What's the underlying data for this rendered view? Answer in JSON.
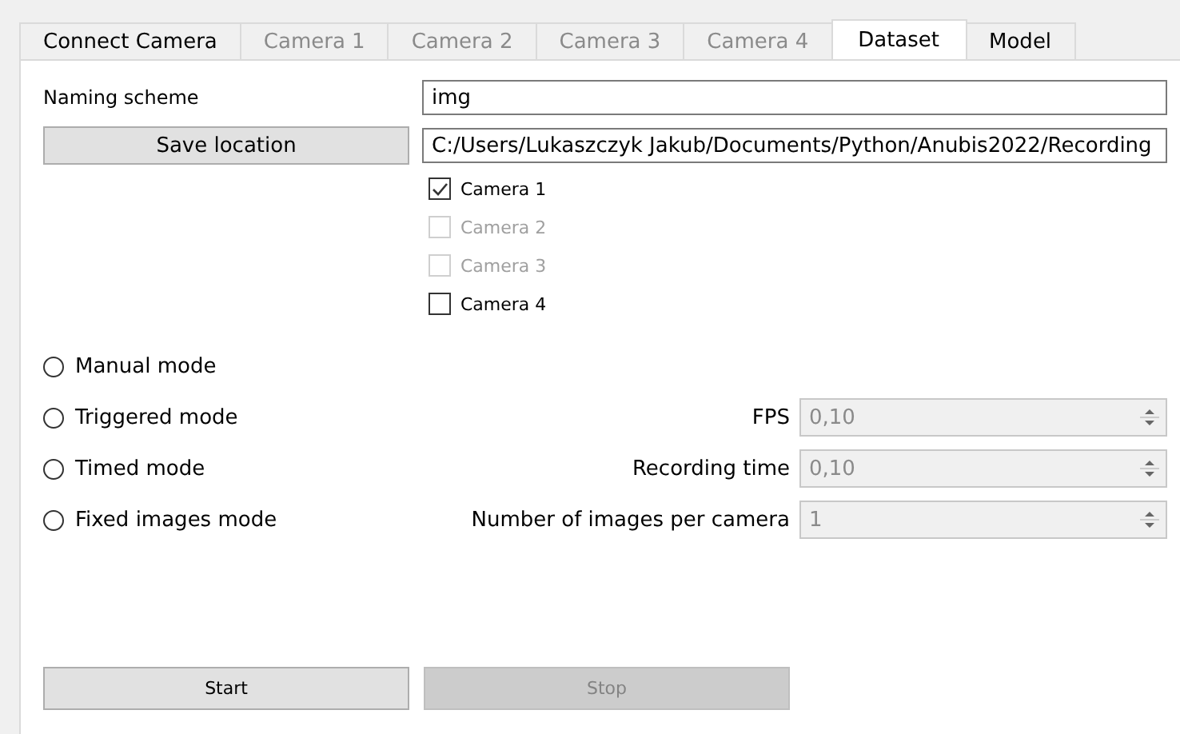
{
  "tabs": [
    {
      "label": "Connect Camera",
      "selected": false,
      "disabled": false
    },
    {
      "label": "Camera 1",
      "selected": false,
      "disabled": true
    },
    {
      "label": "Camera 2",
      "selected": false,
      "disabled": true
    },
    {
      "label": "Camera 3",
      "selected": false,
      "disabled": true
    },
    {
      "label": "Camera 4",
      "selected": false,
      "disabled": true
    },
    {
      "label": "Dataset",
      "selected": true,
      "disabled": false
    },
    {
      "label": "Model",
      "selected": false,
      "disabled": false
    }
  ],
  "naming_scheme": {
    "label": "Naming scheme",
    "value": "img"
  },
  "save_location": {
    "button": "Save location",
    "value": "C:/Users/Lukaszczyk Jakub/Documents/Python/Anubis2022/Recording"
  },
  "cameras": [
    {
      "label": "Camera 1",
      "checked": true,
      "disabled": false
    },
    {
      "label": "Camera 2",
      "checked": false,
      "disabled": true
    },
    {
      "label": "Camera 3",
      "checked": false,
      "disabled": true
    },
    {
      "label": "Camera 4",
      "checked": false,
      "disabled": false
    }
  ],
  "modes": [
    {
      "label": "Manual mode",
      "selected": false
    },
    {
      "label": "Triggered mode",
      "selected": false,
      "setting": {
        "label": "FPS",
        "value": "0,10"
      }
    },
    {
      "label": "Timed mode",
      "selected": false,
      "setting": {
        "label": "Recording time",
        "value": "0,10"
      }
    },
    {
      "label": "Fixed images mode",
      "selected": false,
      "setting": {
        "label": "Number of images per camera",
        "value": "1"
      }
    }
  ],
  "buttons": [
    {
      "label": "Start",
      "disabled": false
    },
    {
      "label": "Stop",
      "disabled": true
    }
  ]
}
